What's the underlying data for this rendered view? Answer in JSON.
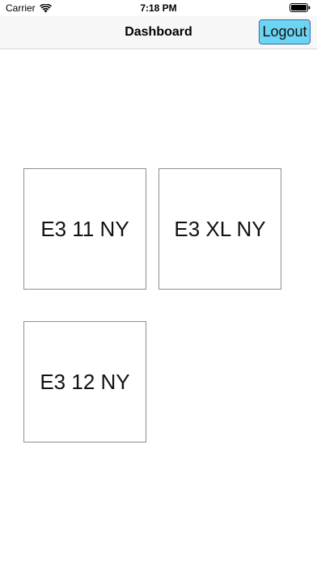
{
  "status_bar": {
    "carrier": "Carrier",
    "time": "7:18 PM",
    "wifi_icon": "wifi-icon",
    "battery_icon": "battery-icon"
  },
  "nav_bar": {
    "title": "Dashboard",
    "logout_label": "Logout",
    "logout_color": "#6ed4f4"
  },
  "tiles": [
    {
      "label": "E3 11 NY"
    },
    {
      "label": "E3 XL NY"
    },
    {
      "label": "E3 12 NY"
    }
  ]
}
